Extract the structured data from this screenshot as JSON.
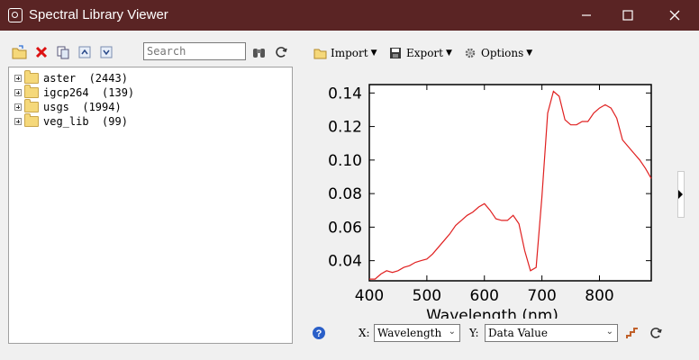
{
  "window": {
    "title": "Spectral Library Viewer"
  },
  "left_toolbar": {
    "search_placeholder": "Search"
  },
  "tree": [
    {
      "name": "aster",
      "count": "(2443)"
    },
    {
      "name": "igcp264",
      "count": "(139)"
    },
    {
      "name": "usgs",
      "count": "(1994)"
    },
    {
      "name": "veg_lib",
      "count": "(99)"
    }
  ],
  "right_toolbar": {
    "import": "Import",
    "export": "Export",
    "options": "Options"
  },
  "bottom": {
    "x_label": "X:",
    "x_value": "Wavelength",
    "y_label": "Y:",
    "y_value": "Data Value"
  },
  "chart_data": {
    "type": "line",
    "xlabel": "Wavelength (nm)",
    "ylabel": "Data Value",
    "xlim": [
      400,
      890
    ],
    "ylim": [
      0.028,
      0.145
    ],
    "x_ticks": [
      400,
      500,
      600,
      700,
      800
    ],
    "y_ticks": [
      0.04,
      0.06,
      0.08,
      0.1,
      0.12,
      0.14
    ],
    "series_color": "#e02020",
    "points": [
      [
        400,
        0.029
      ],
      [
        410,
        0.029
      ],
      [
        420,
        0.032
      ],
      [
        430,
        0.034
      ],
      [
        440,
        0.033
      ],
      [
        450,
        0.034
      ],
      [
        460,
        0.036
      ],
      [
        470,
        0.037
      ],
      [
        480,
        0.039
      ],
      [
        490,
        0.04
      ],
      [
        500,
        0.041
      ],
      [
        510,
        0.044
      ],
      [
        520,
        0.048
      ],
      [
        530,
        0.052
      ],
      [
        540,
        0.056
      ],
      [
        550,
        0.061
      ],
      [
        560,
        0.064
      ],
      [
        570,
        0.067
      ],
      [
        580,
        0.069
      ],
      [
        590,
        0.072
      ],
      [
        600,
        0.074
      ],
      [
        610,
        0.07
      ],
      [
        620,
        0.065
      ],
      [
        630,
        0.064
      ],
      [
        640,
        0.064
      ],
      [
        650,
        0.067
      ],
      [
        660,
        0.062
      ],
      [
        670,
        0.046
      ],
      [
        680,
        0.034
      ],
      [
        690,
        0.036
      ],
      [
        700,
        0.078
      ],
      [
        710,
        0.128
      ],
      [
        720,
        0.141
      ],
      [
        730,
        0.138
      ],
      [
        740,
        0.124
      ],
      [
        750,
        0.121
      ],
      [
        760,
        0.121
      ],
      [
        770,
        0.123
      ],
      [
        780,
        0.123
      ],
      [
        790,
        0.128
      ],
      [
        800,
        0.131
      ],
      [
        810,
        0.133
      ],
      [
        820,
        0.131
      ],
      [
        830,
        0.125
      ],
      [
        840,
        0.112
      ],
      [
        850,
        0.108
      ],
      [
        860,
        0.104
      ],
      [
        870,
        0.1
      ],
      [
        880,
        0.095
      ],
      [
        890,
        0.089
      ]
    ]
  }
}
